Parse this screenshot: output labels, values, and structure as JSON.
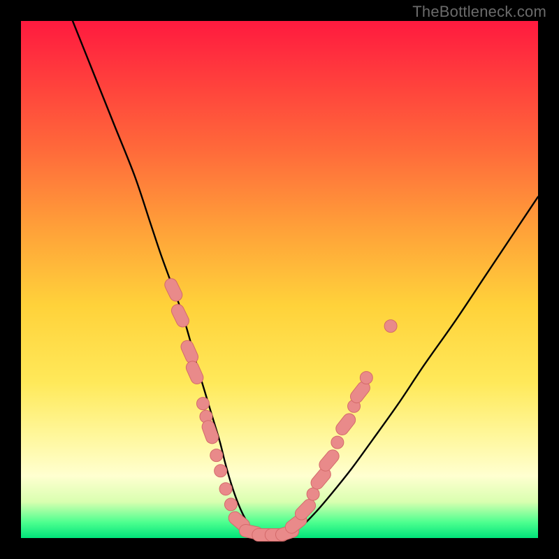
{
  "attribution": "TheBottleneck.com",
  "colors": {
    "frame": "#000000",
    "curve": "#000000",
    "marker_fill": "#e98a8a",
    "marker_stroke": "#d46a6a",
    "gradient_top": "#ff1a3f",
    "gradient_bottom": "#00e37a"
  },
  "chart_data": {
    "type": "line",
    "title": "",
    "xlabel": "",
    "ylabel": "",
    "xlim": [
      0,
      100
    ],
    "ylim": [
      0,
      100
    ],
    "grid": false,
    "legend": false,
    "series": [
      {
        "name": "bottleneck-curve",
        "x": [
          10,
          14,
          18,
          22,
          25,
          27,
          29,
          31,
          32.5,
          34,
          35.5,
          37,
          38.5,
          39.5,
          40.5,
          41.5,
          42.5,
          43.5,
          44.5,
          46,
          48,
          50,
          52,
          54.5,
          57,
          60,
          64,
          68,
          73,
          78,
          84,
          90,
          96,
          100
        ],
        "y": [
          100,
          90,
          80,
          70,
          61,
          55,
          49.5,
          44,
          39,
          33.5,
          28.5,
          23.5,
          18.5,
          14.5,
          11,
          8,
          5.5,
          3.5,
          2,
          1,
          0.5,
          0.5,
          1,
          2.5,
          5,
          8.5,
          13.5,
          19,
          26,
          33.5,
          42,
          51,
          60,
          66
        ]
      }
    ],
    "markers": [
      {
        "x": 29.5,
        "y": 48,
        "kind": "capsule",
        "angle": 64
      },
      {
        "x": 30.8,
        "y": 43,
        "kind": "capsule",
        "angle": 64
      },
      {
        "x": 32.6,
        "y": 36,
        "kind": "capsule",
        "angle": 66
      },
      {
        "x": 33.6,
        "y": 32,
        "kind": "capsule",
        "angle": 66
      },
      {
        "x": 35.2,
        "y": 26,
        "kind": "dot"
      },
      {
        "x": 35.8,
        "y": 23.5,
        "kind": "dot"
      },
      {
        "x": 36.6,
        "y": 20.5,
        "kind": "capsule",
        "angle": 70
      },
      {
        "x": 37.8,
        "y": 16,
        "kind": "dot"
      },
      {
        "x": 38.6,
        "y": 13,
        "kind": "dot"
      },
      {
        "x": 39.6,
        "y": 9.5,
        "kind": "dot"
      },
      {
        "x": 40.6,
        "y": 6.5,
        "kind": "dot"
      },
      {
        "x": 42.2,
        "y": 3.2,
        "kind": "capsule",
        "angle": 40
      },
      {
        "x": 44.5,
        "y": 1.2,
        "kind": "capsule",
        "angle": 12
      },
      {
        "x": 47.0,
        "y": 0.6,
        "kind": "capsule",
        "angle": 0
      },
      {
        "x": 49.5,
        "y": 0.6,
        "kind": "capsule",
        "angle": 0
      },
      {
        "x": 51.5,
        "y": 1.0,
        "kind": "capsule",
        "angle": -18
      },
      {
        "x": 53.2,
        "y": 2.8,
        "kind": "capsule",
        "angle": -38
      },
      {
        "x": 55.0,
        "y": 5.5,
        "kind": "capsule",
        "angle": -46
      },
      {
        "x": 56.5,
        "y": 8.5,
        "kind": "dot"
      },
      {
        "x": 58.0,
        "y": 11.5,
        "kind": "capsule",
        "angle": -50
      },
      {
        "x": 59.6,
        "y": 15.0,
        "kind": "capsule",
        "angle": -50
      },
      {
        "x": 61.2,
        "y": 18.5,
        "kind": "dot"
      },
      {
        "x": 62.8,
        "y": 22.0,
        "kind": "capsule",
        "angle": -52
      },
      {
        "x": 64.4,
        "y": 25.5,
        "kind": "dot"
      },
      {
        "x": 65.6,
        "y": 28.2,
        "kind": "capsule",
        "angle": -52
      },
      {
        "x": 66.8,
        "y": 31.0,
        "kind": "dot"
      },
      {
        "x": 71.5,
        "y": 41.0,
        "kind": "dot"
      }
    ]
  }
}
